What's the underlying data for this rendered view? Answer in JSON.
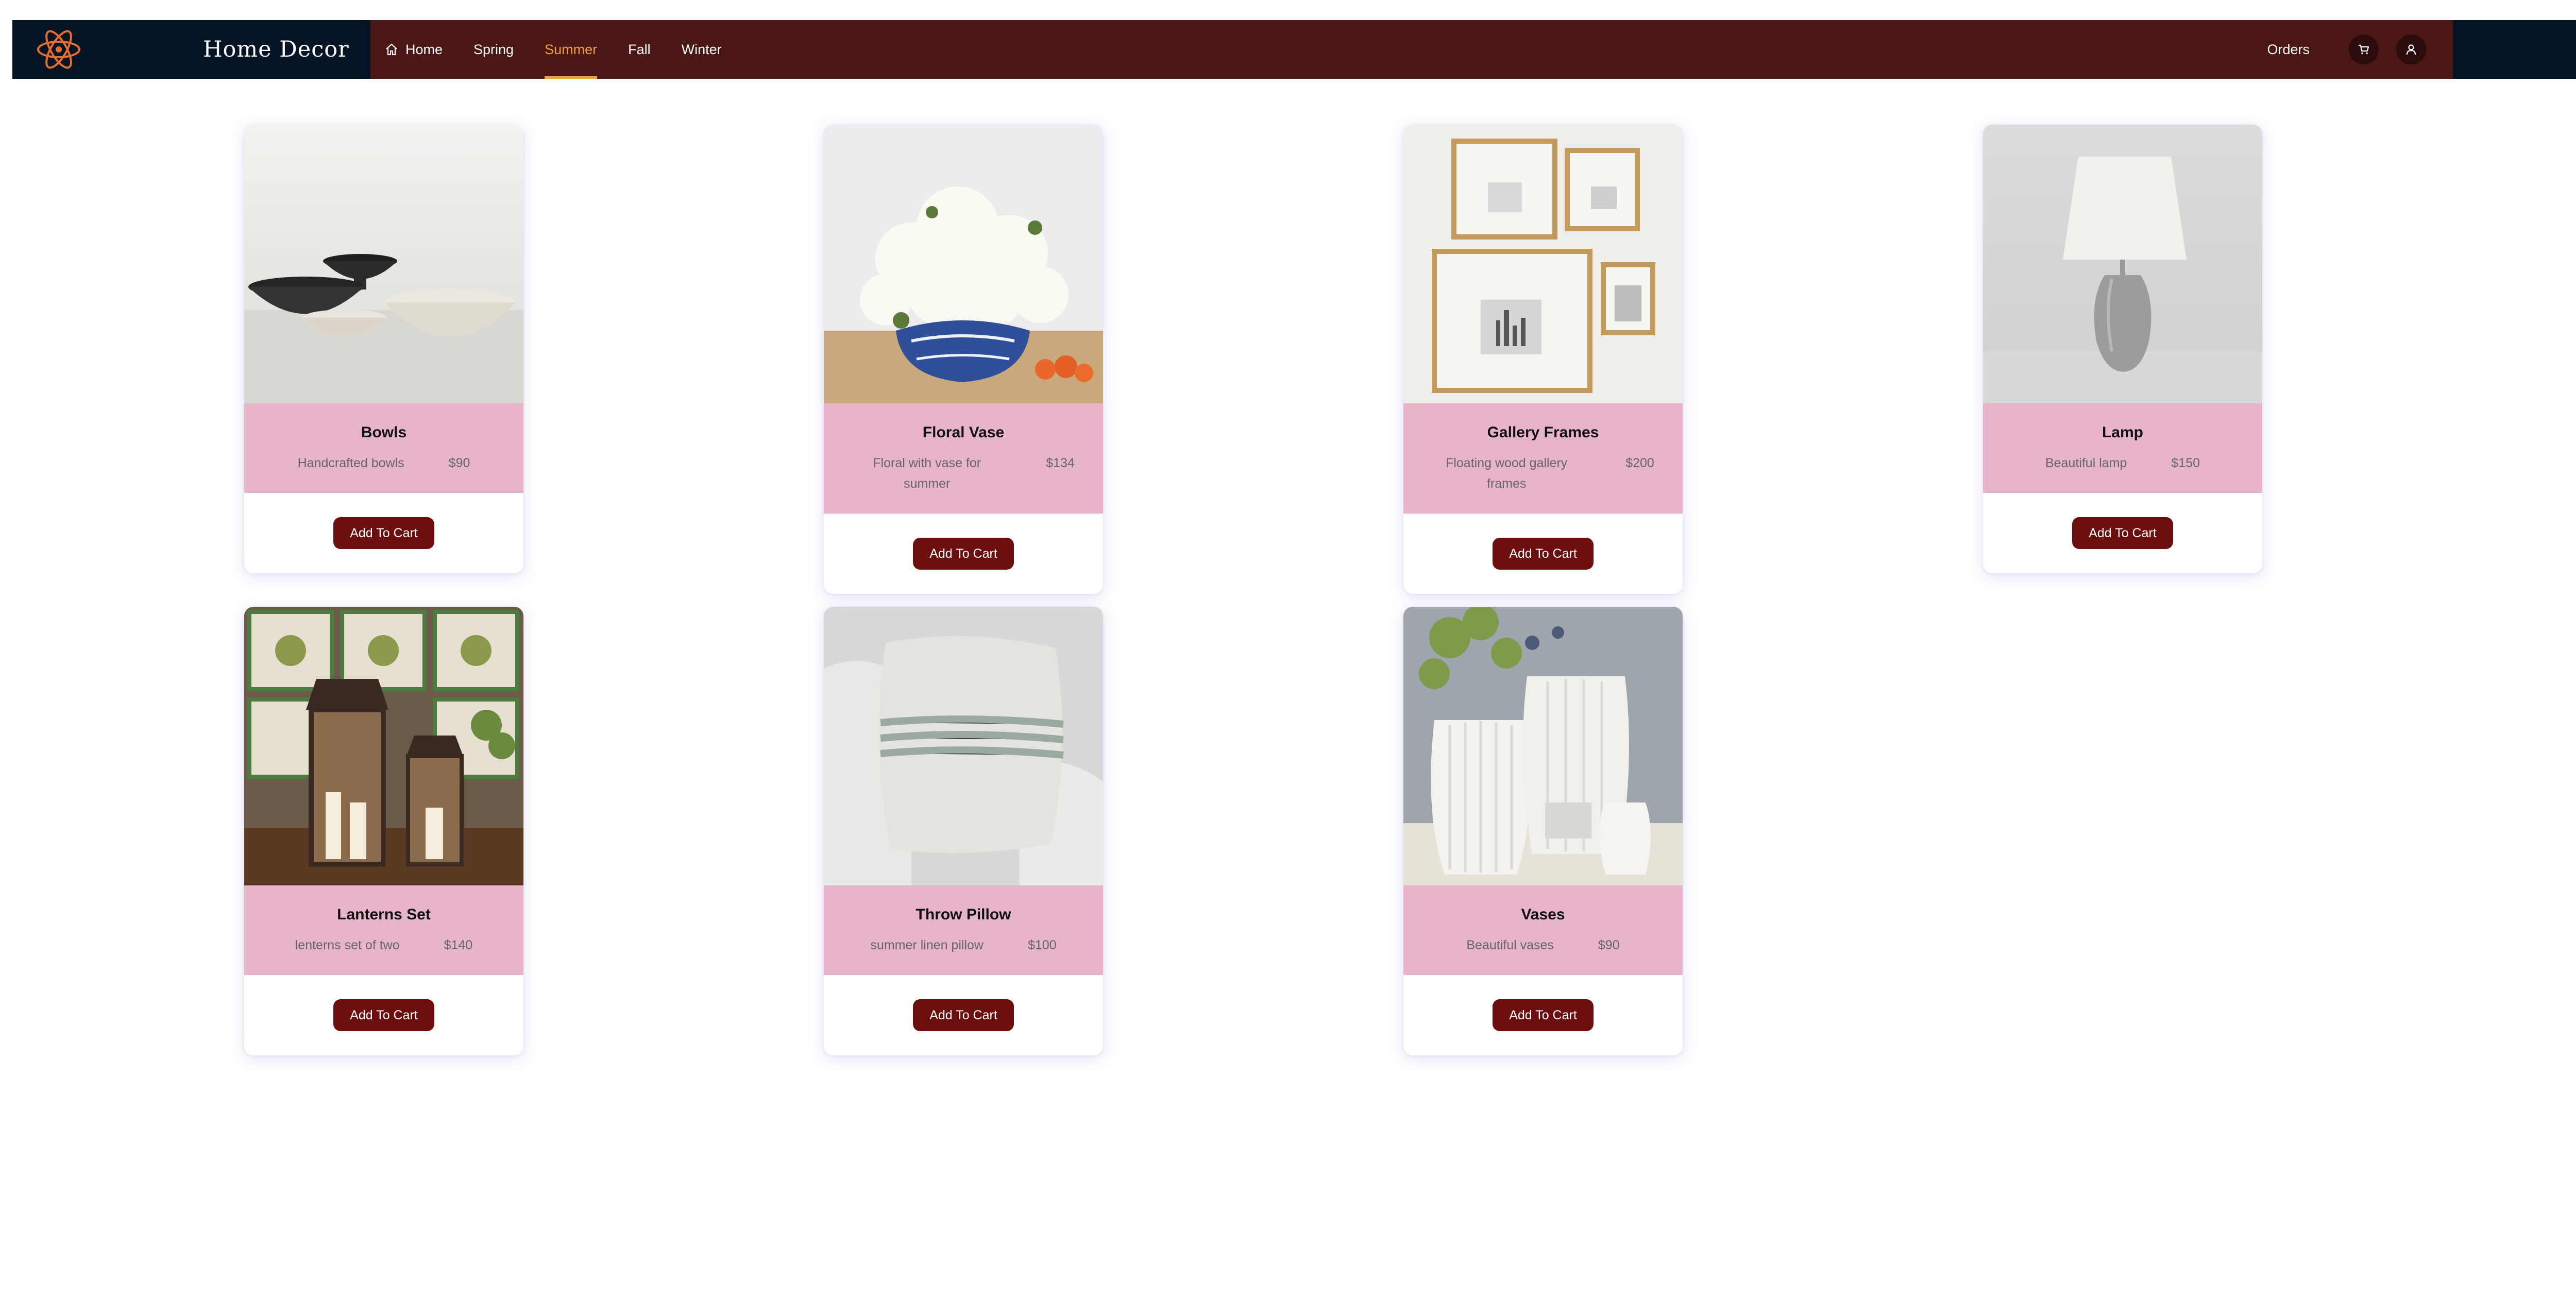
{
  "brand": {
    "name": "Home Decor",
    "logo_icon": "atom-icon",
    "logo_color": "#e86d2a"
  },
  "nav": {
    "links": [
      {
        "label": "Home",
        "icon": "home-icon"
      },
      {
        "label": "Spring"
      },
      {
        "label": "Summer",
        "active": true
      },
      {
        "label": "Fall"
      },
      {
        "label": "Winter"
      }
    ],
    "orders_label": "Orders",
    "cart_icon": "cart-icon",
    "user_icon": "user-icon"
  },
  "colors": {
    "nav_dark": "#031425",
    "nav_maroon": "#4a1616",
    "active_accent": "#f2a23a",
    "card_info_bg": "#e8b4ca",
    "button_bg": "#6e0d0d"
  },
  "products": [
    {
      "title": "Bowls",
      "description": "Handcrafted bowls",
      "price": "$90",
      "button": "Add To Cart"
    },
    {
      "title": "Floral Vase",
      "description": "Floral with vase for summer",
      "price": "$134",
      "button": "Add To Cart"
    },
    {
      "title": "Gallery Frames",
      "description": "Floating wood gallery frames",
      "price": "$200",
      "button": "Add To Cart"
    },
    {
      "title": "Lamp",
      "description": "Beautiful lamp",
      "price": "$150",
      "button": "Add To Cart"
    },
    {
      "title": "Lanterns Set",
      "description": "lenterns set of two",
      "price": "$140",
      "button": "Add To Cart"
    },
    {
      "title": "Throw Pillow",
      "description": "summer linen pillow",
      "price": "$100",
      "button": "Add To Cart"
    },
    {
      "title": "Vases",
      "description": "Beautiful vases",
      "price": "$90",
      "button": "Add To Cart"
    }
  ]
}
